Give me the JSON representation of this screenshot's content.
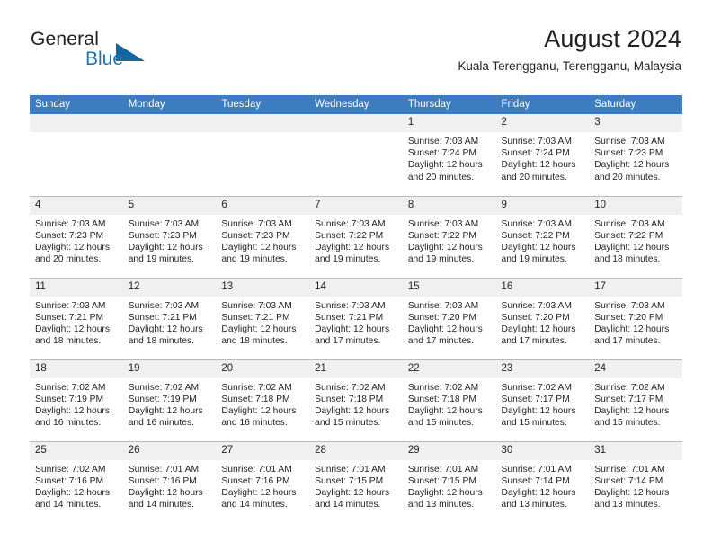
{
  "brand": {
    "name_top": "General",
    "name_bottom": "Blue",
    "accent_color": "#1f74bb",
    "triangle_color": "#15659f"
  },
  "header": {
    "title": "August 2024",
    "location": "Kuala Terengganu, Terengganu, Malaysia"
  },
  "calendar": {
    "header_background": "#3b7dc0",
    "header_text_color": "#ffffff",
    "daynum_background": "#f0f0f0",
    "weekday_headers": [
      "Sunday",
      "Monday",
      "Tuesday",
      "Wednesday",
      "Thursday",
      "Friday",
      "Saturday"
    ],
    "weeks": [
      [
        {
          "day": "",
          "l1": "",
          "l2": "",
          "l3": "",
          "l4": ""
        },
        {
          "day": "",
          "l1": "",
          "l2": "",
          "l3": "",
          "l4": ""
        },
        {
          "day": "",
          "l1": "",
          "l2": "",
          "l3": "",
          "l4": ""
        },
        {
          "day": "",
          "l1": "",
          "l2": "",
          "l3": "",
          "l4": ""
        },
        {
          "day": "1",
          "l1": "Sunrise: 7:03 AM",
          "l2": "Sunset: 7:24 PM",
          "l3": "Daylight: 12 hours",
          "l4": "and 20 minutes."
        },
        {
          "day": "2",
          "l1": "Sunrise: 7:03 AM",
          "l2": "Sunset: 7:24 PM",
          "l3": "Daylight: 12 hours",
          "l4": "and 20 minutes."
        },
        {
          "day": "3",
          "l1": "Sunrise: 7:03 AM",
          "l2": "Sunset: 7:23 PM",
          "l3": "Daylight: 12 hours",
          "l4": "and 20 minutes."
        }
      ],
      [
        {
          "day": "4",
          "l1": "Sunrise: 7:03 AM",
          "l2": "Sunset: 7:23 PM",
          "l3": "Daylight: 12 hours",
          "l4": "and 20 minutes."
        },
        {
          "day": "5",
          "l1": "Sunrise: 7:03 AM",
          "l2": "Sunset: 7:23 PM",
          "l3": "Daylight: 12 hours",
          "l4": "and 19 minutes."
        },
        {
          "day": "6",
          "l1": "Sunrise: 7:03 AM",
          "l2": "Sunset: 7:23 PM",
          "l3": "Daylight: 12 hours",
          "l4": "and 19 minutes."
        },
        {
          "day": "7",
          "l1": "Sunrise: 7:03 AM",
          "l2": "Sunset: 7:22 PM",
          "l3": "Daylight: 12 hours",
          "l4": "and 19 minutes."
        },
        {
          "day": "8",
          "l1": "Sunrise: 7:03 AM",
          "l2": "Sunset: 7:22 PM",
          "l3": "Daylight: 12 hours",
          "l4": "and 19 minutes."
        },
        {
          "day": "9",
          "l1": "Sunrise: 7:03 AM",
          "l2": "Sunset: 7:22 PM",
          "l3": "Daylight: 12 hours",
          "l4": "and 19 minutes."
        },
        {
          "day": "10",
          "l1": "Sunrise: 7:03 AM",
          "l2": "Sunset: 7:22 PM",
          "l3": "Daylight: 12 hours",
          "l4": "and 18 minutes."
        }
      ],
      [
        {
          "day": "11",
          "l1": "Sunrise: 7:03 AM",
          "l2": "Sunset: 7:21 PM",
          "l3": "Daylight: 12 hours",
          "l4": "and 18 minutes."
        },
        {
          "day": "12",
          "l1": "Sunrise: 7:03 AM",
          "l2": "Sunset: 7:21 PM",
          "l3": "Daylight: 12 hours",
          "l4": "and 18 minutes."
        },
        {
          "day": "13",
          "l1": "Sunrise: 7:03 AM",
          "l2": "Sunset: 7:21 PM",
          "l3": "Daylight: 12 hours",
          "l4": "and 18 minutes."
        },
        {
          "day": "14",
          "l1": "Sunrise: 7:03 AM",
          "l2": "Sunset: 7:21 PM",
          "l3": "Daylight: 12 hours",
          "l4": "and 17 minutes."
        },
        {
          "day": "15",
          "l1": "Sunrise: 7:03 AM",
          "l2": "Sunset: 7:20 PM",
          "l3": "Daylight: 12 hours",
          "l4": "and 17 minutes."
        },
        {
          "day": "16",
          "l1": "Sunrise: 7:03 AM",
          "l2": "Sunset: 7:20 PM",
          "l3": "Daylight: 12 hours",
          "l4": "and 17 minutes."
        },
        {
          "day": "17",
          "l1": "Sunrise: 7:03 AM",
          "l2": "Sunset: 7:20 PM",
          "l3": "Daylight: 12 hours",
          "l4": "and 17 minutes."
        }
      ],
      [
        {
          "day": "18",
          "l1": "Sunrise: 7:02 AM",
          "l2": "Sunset: 7:19 PM",
          "l3": "Daylight: 12 hours",
          "l4": "and 16 minutes."
        },
        {
          "day": "19",
          "l1": "Sunrise: 7:02 AM",
          "l2": "Sunset: 7:19 PM",
          "l3": "Daylight: 12 hours",
          "l4": "and 16 minutes."
        },
        {
          "day": "20",
          "l1": "Sunrise: 7:02 AM",
          "l2": "Sunset: 7:18 PM",
          "l3": "Daylight: 12 hours",
          "l4": "and 16 minutes."
        },
        {
          "day": "21",
          "l1": "Sunrise: 7:02 AM",
          "l2": "Sunset: 7:18 PM",
          "l3": "Daylight: 12 hours",
          "l4": "and 15 minutes."
        },
        {
          "day": "22",
          "l1": "Sunrise: 7:02 AM",
          "l2": "Sunset: 7:18 PM",
          "l3": "Daylight: 12 hours",
          "l4": "and 15 minutes."
        },
        {
          "day": "23",
          "l1": "Sunrise: 7:02 AM",
          "l2": "Sunset: 7:17 PM",
          "l3": "Daylight: 12 hours",
          "l4": "and 15 minutes."
        },
        {
          "day": "24",
          "l1": "Sunrise: 7:02 AM",
          "l2": "Sunset: 7:17 PM",
          "l3": "Daylight: 12 hours",
          "l4": "and 15 minutes."
        }
      ],
      [
        {
          "day": "25",
          "l1": "Sunrise: 7:02 AM",
          "l2": "Sunset: 7:16 PM",
          "l3": "Daylight: 12 hours",
          "l4": "and 14 minutes."
        },
        {
          "day": "26",
          "l1": "Sunrise: 7:01 AM",
          "l2": "Sunset: 7:16 PM",
          "l3": "Daylight: 12 hours",
          "l4": "and 14 minutes."
        },
        {
          "day": "27",
          "l1": "Sunrise: 7:01 AM",
          "l2": "Sunset: 7:16 PM",
          "l3": "Daylight: 12 hours",
          "l4": "and 14 minutes."
        },
        {
          "day": "28",
          "l1": "Sunrise: 7:01 AM",
          "l2": "Sunset: 7:15 PM",
          "l3": "Daylight: 12 hours",
          "l4": "and 14 minutes."
        },
        {
          "day": "29",
          "l1": "Sunrise: 7:01 AM",
          "l2": "Sunset: 7:15 PM",
          "l3": "Daylight: 12 hours",
          "l4": "and 13 minutes."
        },
        {
          "day": "30",
          "l1": "Sunrise: 7:01 AM",
          "l2": "Sunset: 7:14 PM",
          "l3": "Daylight: 12 hours",
          "l4": "and 13 minutes."
        },
        {
          "day": "31",
          "l1": "Sunrise: 7:01 AM",
          "l2": "Sunset: 7:14 PM",
          "l3": "Daylight: 12 hours",
          "l4": "and 13 minutes."
        }
      ]
    ]
  }
}
